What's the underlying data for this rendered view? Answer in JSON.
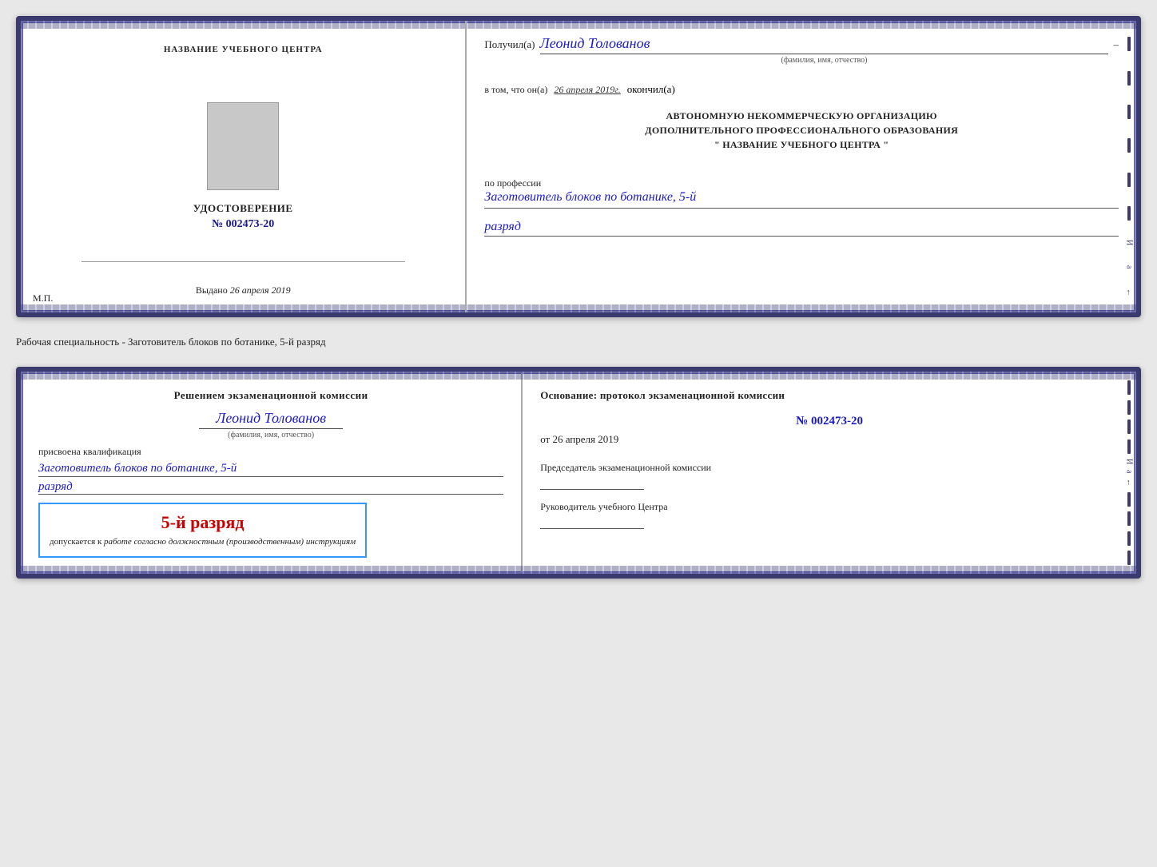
{
  "card1": {
    "left": {
      "center_title": "НАЗВАНИЕ УЧЕБНОГО ЦЕНТРА",
      "cert_title": "УДОСТОВЕРЕНИЕ",
      "cert_number": "№ 002473-20",
      "issued_label": "Выдано",
      "issued_date": "26 апреля 2019",
      "mp_label": "М.П."
    },
    "right": {
      "received_label": "Получил(а)",
      "recipient_name": "Леонид Толованов",
      "fio_label": "(фамилия, имя, отчество)",
      "certifies_text": "в том, что он(а)",
      "date_certified": "26 апреля 2019г.",
      "completed_label": "окончил(а)",
      "institution_line1": "АВТОНОМНУЮ НЕКОММЕРЧЕСКУЮ ОРГАНИЗАЦИЮ",
      "institution_line2": "ДОПОЛНИТЕЛЬНОГО ПРОФЕССИОНАЛЬНОГО ОБРАЗОВАНИЯ",
      "institution_line3": "\"  НАЗВАНИЕ УЧЕБНОГО ЦЕНТРА  \"",
      "profession_label": "по профессии",
      "profession_value": "Заготовитель блоков по ботанике, 5-й",
      "rank_value": "разряд"
    }
  },
  "separator": {
    "text": "Рабочая специальность - Заготовитель блоков по ботанике, 5-й разряд"
  },
  "card2": {
    "left": {
      "decision_text": "Решением экзаменационной комиссии",
      "person_name": "Леонид Толованов",
      "fio_label": "(фамилия, имя, отчество)",
      "qualification_assigned": "присвоена квалификация",
      "qualification_value": "Заготовитель блоков по ботанике, 5-й",
      "rank_value": "разряд",
      "stamp_rank": "5-й разряд",
      "stamp_admission_text": "допускается к",
      "stamp_italic": "работе согласно должностным (производственным) инструкциям"
    },
    "right": {
      "basis_label": "Основание: протокол экзаменационной комиссии",
      "basis_number": "№  002473-20",
      "basis_date_prefix": "от",
      "basis_date": "26 апреля 2019",
      "chairman_label": "Председатель экзаменационной комиссии",
      "head_label": "Руководитель учебного Центра"
    }
  }
}
